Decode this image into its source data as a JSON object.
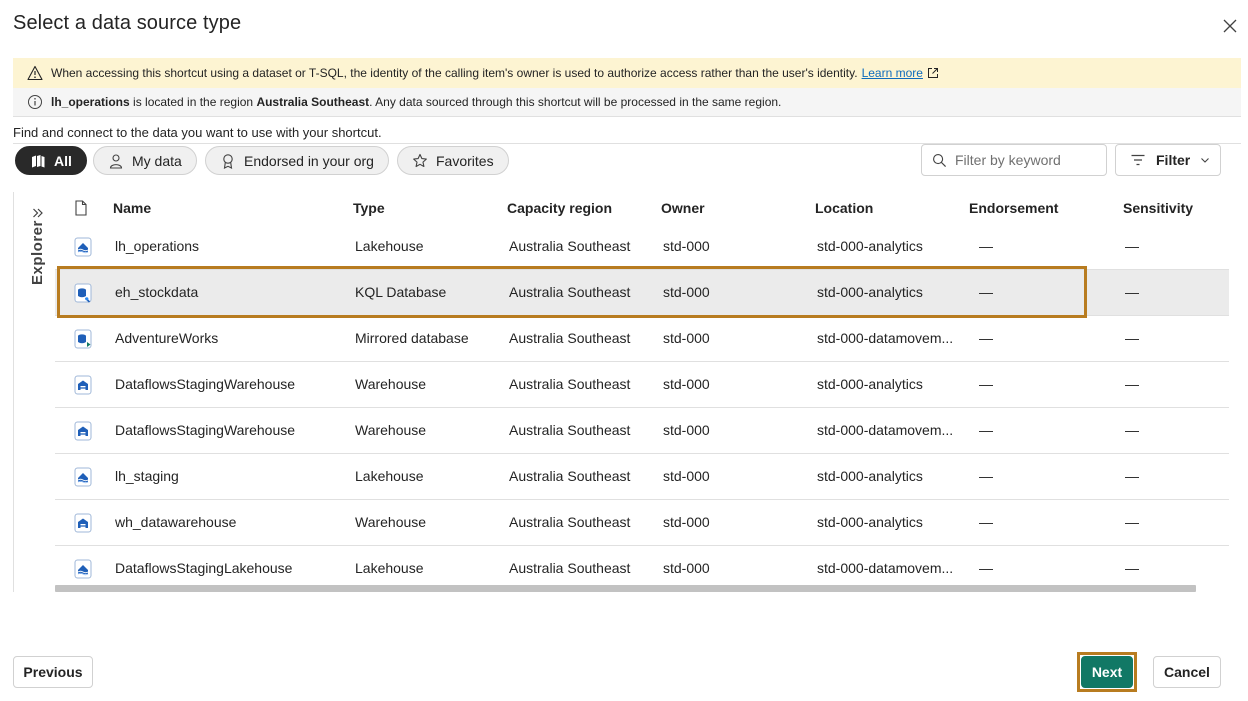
{
  "dialog": {
    "title": "Select a data source type",
    "close_icon": "close-icon"
  },
  "banners": {
    "warning": {
      "icon": "warning-icon",
      "text": "When accessing this shortcut using a dataset or T-SQL, the identity of the calling item's owner is used to authorize access rather than the user's identity.",
      "link": "Learn more",
      "link_icon": "external-link-icon"
    },
    "info": {
      "icon": "info-icon",
      "item_name": "lh_operations",
      "text_mid": " is located in the region ",
      "region": "Australia Southeast",
      "text_end": ". Any data sourced through this shortcut will be processed in the same region."
    }
  },
  "subtitle": "Find and connect to the data you want to use with your shortcut.",
  "filters": {
    "pills": [
      {
        "label": "All",
        "icon": "stack-icon",
        "active": true
      },
      {
        "label": "My data",
        "icon": "person-icon",
        "active": false
      },
      {
        "label": "Endorsed in your org",
        "icon": "ribbon-icon",
        "active": false
      },
      {
        "label": "Favorites",
        "icon": "star-icon",
        "active": false
      }
    ],
    "search_placeholder": "Filter by keyword",
    "filter_label": "Filter"
  },
  "explorer": {
    "label": "Explorer",
    "expand_icon": "double-chevron-right-icon"
  },
  "table": {
    "headers": [
      "Name",
      "Type",
      "Capacity region",
      "Owner",
      "Location",
      "Endorsement",
      "Sensitivity"
    ],
    "rows": [
      {
        "icon": "lakehouse-icon",
        "name": "lh_operations",
        "type": "Lakehouse",
        "region": "Australia Southeast",
        "owner": "std-000",
        "location": "std-000-analytics",
        "endorsement": "—",
        "sensitivity": "—"
      },
      {
        "icon": "kql-database-icon",
        "name": "eh_stockdata",
        "type": "KQL Database",
        "region": "Australia Southeast",
        "owner": "std-000",
        "location": "std-000-analytics",
        "endorsement": "—",
        "sensitivity": "—"
      },
      {
        "icon": "mirrored-database-icon",
        "name": "AdventureWorks",
        "type": "Mirrored database",
        "region": "Australia Southeast",
        "owner": "std-000",
        "location": "std-000-datamovem...",
        "endorsement": "—",
        "sensitivity": "—"
      },
      {
        "icon": "warehouse-icon",
        "name": "DataflowsStagingWarehouse",
        "type": "Warehouse",
        "region": "Australia Southeast",
        "owner": "std-000",
        "location": "std-000-analytics",
        "endorsement": "—",
        "sensitivity": "—"
      },
      {
        "icon": "warehouse-icon",
        "name": "DataflowsStagingWarehouse",
        "type": "Warehouse",
        "region": "Australia Southeast",
        "owner": "std-000",
        "location": "std-000-datamovem...",
        "endorsement": "—",
        "sensitivity": "—"
      },
      {
        "icon": "lakehouse-icon",
        "name": "lh_staging",
        "type": "Lakehouse",
        "region": "Australia Southeast",
        "owner": "std-000",
        "location": "std-000-analytics",
        "endorsement": "—",
        "sensitivity": "—"
      },
      {
        "icon": "warehouse-icon",
        "name": "wh_datawarehouse",
        "type": "Warehouse",
        "region": "Australia Southeast",
        "owner": "std-000",
        "location": "std-000-analytics",
        "endorsement": "—",
        "sensitivity": "—"
      },
      {
        "icon": "lakehouse-icon",
        "name": "DataflowsStagingLakehouse",
        "type": "Lakehouse",
        "region": "Australia Southeast",
        "owner": "std-000",
        "location": "std-000-datamovem...",
        "endorsement": "—",
        "sensitivity": "—"
      }
    ],
    "selected_index": 1
  },
  "footer": {
    "previous": "Previous",
    "next": "Next",
    "cancel": "Cancel"
  },
  "colors": {
    "accent": "#117865",
    "highlight": "#b87c20",
    "warning_bg": "#fdf4d2"
  }
}
